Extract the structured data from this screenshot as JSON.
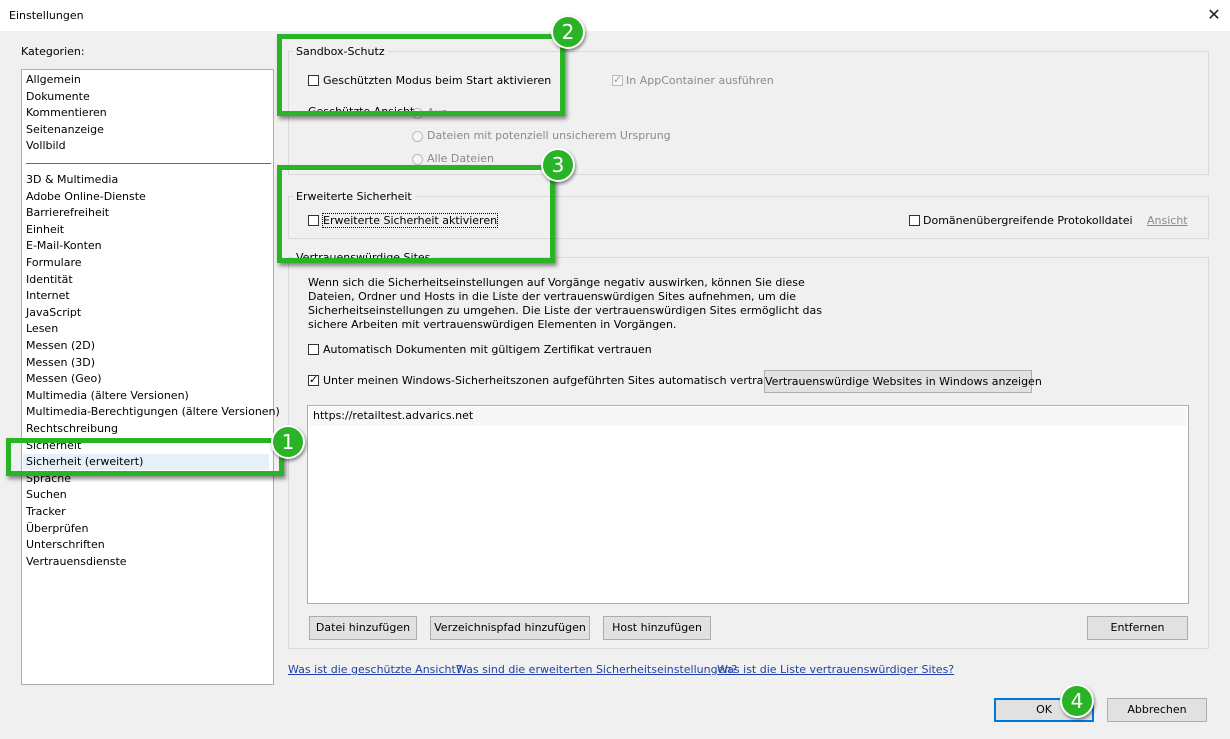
{
  "window": {
    "title": "Einstellungen",
    "close_glyph": "✕"
  },
  "categories": {
    "label": "Kategorien:",
    "group1": [
      "Allgemein",
      "Dokumente",
      "Kommentieren",
      "Seitenanzeige",
      "Vollbild"
    ],
    "group2": [
      "3D & Multimedia",
      "Adobe Online-Dienste",
      "Barrierefreiheit",
      "Einheit",
      "E-Mail-Konten",
      "Formulare",
      "Identität",
      "Internet",
      "JavaScript",
      "Lesen",
      "Messen (2D)",
      "Messen (3D)",
      "Messen (Geo)",
      "Multimedia (ältere Versionen)",
      "Multimedia-Berechtigungen (ältere Versionen)",
      "Rechtschreibung",
      "Sicherheit",
      "Sicherheit (erweitert)",
      "Sprache",
      "Suchen",
      "Tracker",
      "Überprüfen",
      "Unterschriften",
      "Vertrauensdienste"
    ],
    "selected": "Sicherheit (erweitert)"
  },
  "sandbox": {
    "legend": "Sandbox-Schutz",
    "protected_mode_label": "Geschützten Modus beim Start aktivieren",
    "protected_mode_checked": false,
    "appcontainer_label": "In AppContainer ausführen",
    "appcontainer_checked": true,
    "protected_view_label": "Geschützte Ansicht",
    "radio_off": "Aus",
    "radio_unsafe": "Dateien mit potenziell unsicherem Ursprung",
    "radio_all": "Alle Dateien"
  },
  "enhanced": {
    "legend": "Erweiterte Sicherheit",
    "enable_label": "Erweiterte Sicherheit aktivieren",
    "enable_checked": false,
    "crossdomain_label": "Domänenübergreifende Protokolldatei",
    "crossdomain_checked": false,
    "view_label": "Ansicht"
  },
  "trusted": {
    "legend": "Vertrauenswürdige Sites",
    "description": [
      "Wenn sich die Sicherheitseinstellungen auf Vorgänge negativ auswirken,  können Sie diese",
      "Dateien, Ordner und Hosts in die Liste der vertrauenswürdigen Sites aufnehmen, um die",
      "Sicherheitseinstellungen zu umgehen. Die Liste der vertrauenswürdigen Sites ermöglicht das",
      "sichere Arbeiten mit vertrauenswürdigen Elementen in Vorgängen."
    ],
    "auto_cert_label": "Automatisch Dokumenten mit gültigem Zertifikat vertrauen",
    "auto_cert_checked": false,
    "win_zones_label": "Unter meinen Windows-Sicherheitszonen aufgeführten Sites automatisch vertrauen",
    "win_zones_checked": true,
    "show_windows_sites_button": "Vertrauenswürdige Websites in Windows anzeigen",
    "sites": [
      "https://retailtest.advarics.net"
    ],
    "add_file_button": "Datei hinzufügen",
    "add_folder_button": "Verzeichnispfad hinzufügen",
    "add_host_button": "Host hinzufügen",
    "remove_button": "Entfernen"
  },
  "help_links": {
    "protected_view": "Was ist die geschützte Ansicht?",
    "enhanced_security": "Was sind die erweiterten Sicherheitseinstellungen?",
    "trusted_list": "Was ist die Liste vertrauenswürdiger Sites?"
  },
  "footer": {
    "ok": "OK",
    "cancel": "Abbrechen"
  },
  "annotations": {
    "colors": {
      "highlight": "#2ab326"
    },
    "badges": [
      "1",
      "2",
      "3",
      "4"
    ]
  }
}
